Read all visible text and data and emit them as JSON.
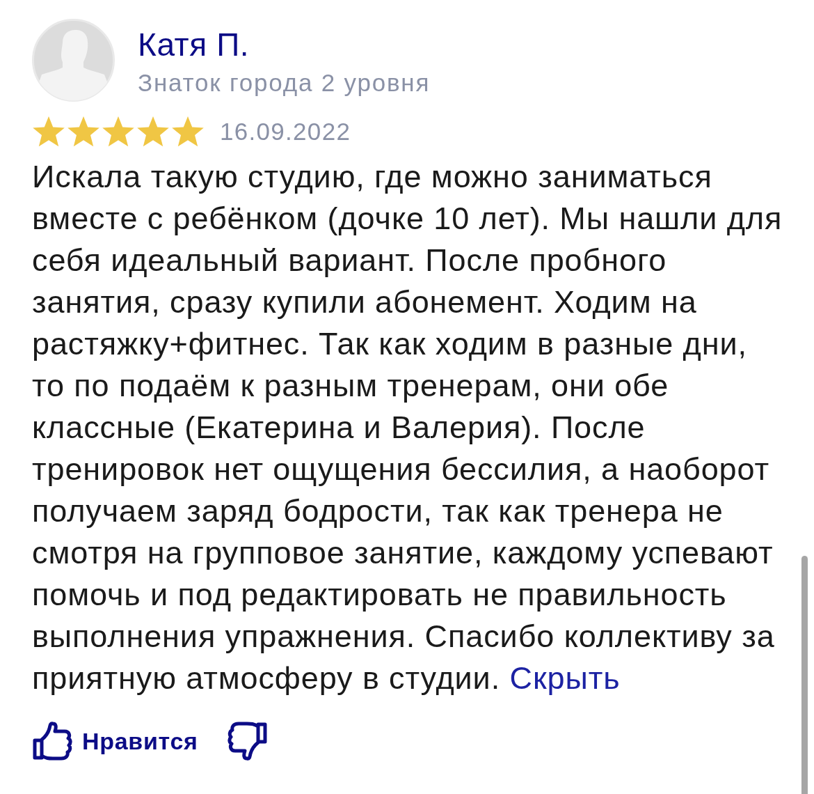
{
  "author": {
    "name": "Катя П.",
    "status": "Знаток города 2 уровня"
  },
  "review": {
    "stars": 5,
    "date": "16.09.2022",
    "text": "Искала такую студию, где можно заниматься вместе с ребёнком (дочке 10 лет). Мы нашли для себя идеальный вариант. После пробного занятия, сразу купили абонемент. Ходим на растяжку+фитнес. Так как ходим в разные дни, то по подаём к разным тренерам, они обе классные (Екатерина и Валерия). После тренировок нет ощущения бессилия, а наоборот получаем заряд бодрости, так как тренера не смотря на групповое занятие, каждому успевают помочь и под редактировать не правильность выполнения упражнения. Спасибо коллективу за приятную атмосферу в студии.",
    "collapse_link": "Скрыть"
  },
  "actions": {
    "like": "Нравится"
  }
}
